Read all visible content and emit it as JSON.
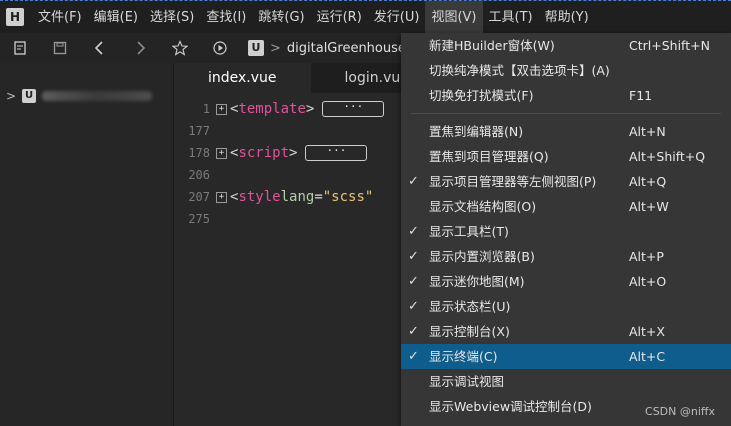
{
  "menubar": {
    "logo": "H",
    "items": [
      "文件(F)",
      "编辑(E)",
      "选择(S)",
      "查找(I)",
      "跳转(G)",
      "运行(R)",
      "发行(U)",
      "视图(V)",
      "工具(T)",
      "帮助(Y)"
    ],
    "active_index": 7
  },
  "toolbar": {
    "icons": [
      "new-file-icon",
      "save-icon",
      "back-icon",
      "forward-icon",
      "star-icon",
      "run-icon"
    ],
    "crumb_logo": "U",
    "crumb_separator": ">",
    "crumb_text": "digitalGreenhouse"
  },
  "sidebar": {
    "project_logo": "U",
    "chevron": ">"
  },
  "tabs": [
    {
      "label": "index.vue",
      "active": true
    },
    {
      "label": "login.vu",
      "active": false
    }
  ],
  "editor": {
    "lines": [
      {
        "num": "1",
        "fold": "+",
        "open": "<",
        "tag": "template",
        "close": ">",
        "collapsed": "···"
      },
      {
        "num": "177"
      },
      {
        "num": "178",
        "fold": "+",
        "open": "<",
        "tag": "script",
        "close": ">",
        "collapsed": "···"
      },
      {
        "num": "206"
      },
      {
        "num": "207",
        "fold": "+",
        "open": "<",
        "tag": "style",
        "attr": "lang",
        "eq": "=",
        "str": "\"scss\""
      },
      {
        "num": "275"
      }
    ]
  },
  "view_menu": {
    "items": [
      {
        "label": "新建HBuilder窗体(W)",
        "shortcut": "Ctrl+Shift+N",
        "checked": false
      },
      {
        "label": "切换纯净模式【双击选项卡】(A)",
        "shortcut": "",
        "checked": false
      },
      {
        "label": "切换免打扰模式(F)",
        "shortcut": "F11",
        "checked": false
      },
      {
        "separator": true
      },
      {
        "label": "置焦到编辑器(N)",
        "shortcut": "Alt+N",
        "checked": false
      },
      {
        "label": "置焦到项目管理器(Q)",
        "shortcut": "Alt+Shift+Q",
        "checked": false
      },
      {
        "label": "显示项目管理器等左侧视图(P)",
        "shortcut": "Alt+Q",
        "checked": true
      },
      {
        "label": "显示文档结构图(O)",
        "shortcut": "Alt+W",
        "checked": false
      },
      {
        "label": "显示工具栏(T)",
        "shortcut": "",
        "checked": true
      },
      {
        "label": "显示内置浏览器(B)",
        "shortcut": "Alt+P",
        "checked": true
      },
      {
        "label": "显示迷你地图(M)",
        "shortcut": "Alt+O",
        "checked": true
      },
      {
        "label": "显示状态栏(U)",
        "shortcut": "",
        "checked": true
      },
      {
        "label": "显示控制台(X)",
        "shortcut": "Alt+X",
        "checked": true
      },
      {
        "label": "显示终端(C)",
        "shortcut": "Alt+C",
        "checked": true,
        "highlighted": true
      },
      {
        "label": "显示调试视图",
        "shortcut": "",
        "checked": false
      },
      {
        "label": "显示Webview调试控制台(D)",
        "shortcut": "",
        "checked": false
      }
    ],
    "check_glyph": "✓"
  },
  "watermark": "CSDN @niffx",
  "colors": {
    "highlight": "#0f5d8c",
    "tag": "#e0529c",
    "attr": "#b5cea8",
    "string": "#e6c27a"
  }
}
